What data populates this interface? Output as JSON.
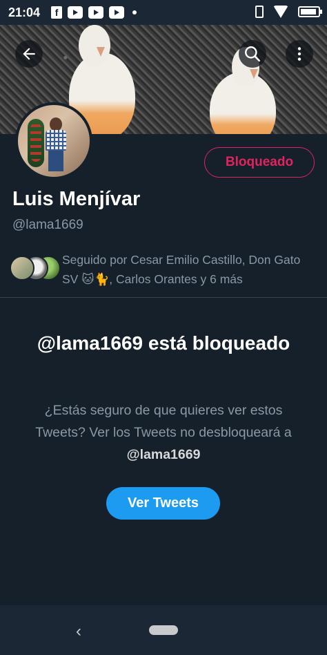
{
  "status_bar": {
    "time": "21:04",
    "notification_icons": [
      "facebook-icon",
      "youtube-icon",
      "youtube-icon",
      "youtube-icon",
      "dot-icon"
    ],
    "right_icons": [
      "vibrate-icon",
      "wifi-icon",
      "battery-icon"
    ]
  },
  "profile": {
    "name": "Luis Menjívar",
    "handle": "@lama1669",
    "blocked_label": "Bloqueado",
    "followed_by_text": "Seguido por Cesar Emilio Castillo, Don Gato SV 🐱🐈, Carlos Orantes y 6 más"
  },
  "blocked_notice": {
    "title": "@lama1669 está bloqueado",
    "desc_prefix": "¿Estás seguro de que quieres ver estos Tweets? Ver los Tweets no desbloqueará a ",
    "desc_handle": "@lama1669",
    "button_label": "Ver Tweets"
  },
  "colors": {
    "background": "#15202b",
    "accent": "#1d9bf0",
    "blocked": "#e0245e",
    "secondary_text": "#8b98a5"
  }
}
